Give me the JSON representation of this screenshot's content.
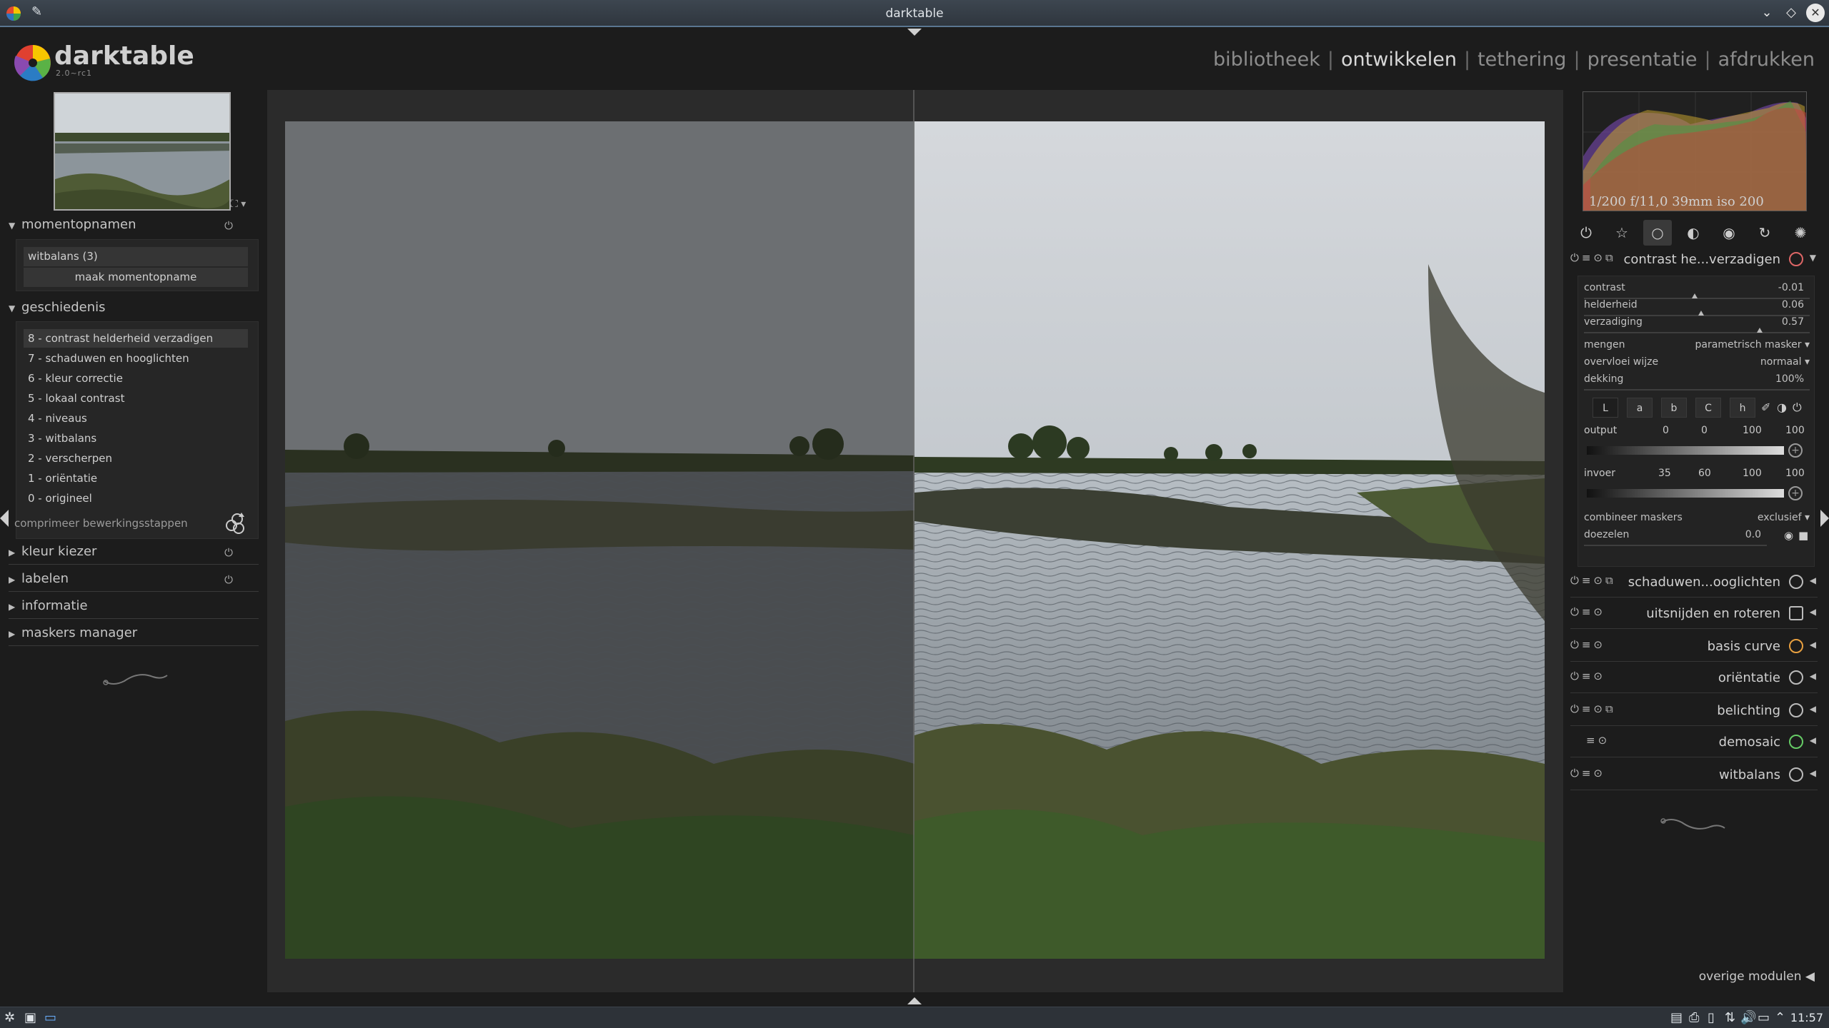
{
  "window": {
    "title": "darktable"
  },
  "header": {
    "logo_text": "darktable",
    "version": "2.0~rc1",
    "views": [
      "bibliotheek",
      "ontwikkelen",
      "tethering",
      "presentatie",
      "afdrukken"
    ],
    "active_view": "ontwikkelen",
    "separator": "|"
  },
  "left": {
    "snapshots": {
      "title": "momentopnamen",
      "items": [
        "witbalans (3)"
      ],
      "button": "maak momentopname"
    },
    "history": {
      "title": "geschiedenis",
      "items": [
        "8 - contrast helderheid verzadigen",
        "7 - schaduwen en hooglichten",
        "6 - kleur correctie",
        "5 - lokaal contrast",
        "4 - niveaus",
        "3 - witbalans",
        "2 - verscherpen",
        "1 - oriëntatie",
        "0 - origineel"
      ],
      "selected_index": 0,
      "compress": "comprimeer bewerkingsstappen"
    },
    "collapsed_sections": [
      "kleur kiezer",
      "labelen",
      "informatie",
      "maskers manager"
    ]
  },
  "right": {
    "histogram_info": "1/200 f/11,0 39mm iso 200",
    "active_module": {
      "name": "contrast he...verzadigen",
      "sliders": [
        {
          "label": "contrast",
          "value": "-0.01",
          "pos": 0.49
        },
        {
          "label": "helderheid",
          "value": "0.06",
          "pos": 0.52
        },
        {
          "label": "verzadiging",
          "value": "0.57",
          "pos": 0.78
        }
      ],
      "blend_mode_label": "mengen",
      "blend_mode_value": "parametrisch masker",
      "overlay_label": "overvloei wijze",
      "overlay_value": "normaal",
      "opacity_label": "dekking",
      "opacity_value": "100%",
      "channels": [
        "L",
        "a",
        "b",
        "C",
        "h"
      ],
      "output_label": "output",
      "output_values": [
        "0",
        "0",
        "100",
        "100"
      ],
      "input_label": "invoer",
      "input_values": [
        "35",
        "60",
        "100",
        "100"
      ],
      "combine_label": "combineer maskers",
      "combine_value": "exclusief",
      "blur_label": "doezelen",
      "blur_value": "0.0"
    },
    "modules": [
      "schaduwen...ooglichten",
      "uitsnijden en roteren",
      "basis curve",
      "oriëntatie",
      "belichting",
      "demosaic",
      "witbalans"
    ],
    "other_modules": "overige modulen"
  },
  "taskbar": {
    "clock": "11:57"
  }
}
